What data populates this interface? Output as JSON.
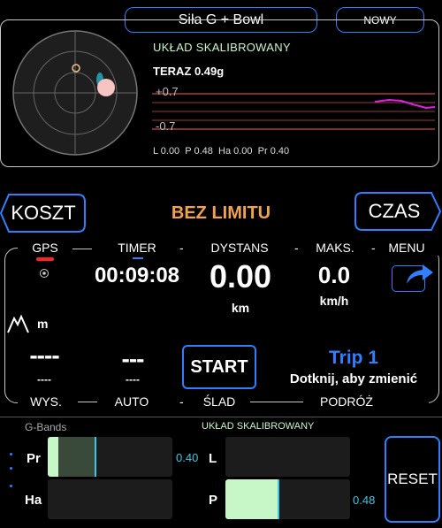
{
  "header": {
    "title": "Siła G + Bowl",
    "new_label": "NOWY"
  },
  "gmeter": {
    "status": "UKŁAD SKALIBROWANY",
    "now_label": "TERAZ 0.49g",
    "top_value": "+0.7",
    "bottom_value": "-0.7",
    "readout": "L 0.00  P 0.48  Ha 0.00  Pr 0.40"
  },
  "middle": {
    "cost_label": "KOSZT",
    "limit_label": "BEZ LIMITU",
    "time_label": "CZAS"
  },
  "dashboard": {
    "gps_label": "GPS",
    "timer_label": "TIMER",
    "distance_label": "DYSTANS",
    "max_label": "MAKS.",
    "menu_label": "MENU",
    "separator": "-",
    "timer_value": "00:09:08",
    "distance_value": "0.00",
    "distance_unit": "km",
    "max_value": "0.0",
    "max_unit": "km/h",
    "altitude_unit": "m",
    "altitude_value": "----",
    "altitude_sub": "----",
    "auto_value": "---",
    "auto_sub": "----",
    "start_label": "START",
    "trip_name": "Trip 1",
    "trip_hint": "Dotknij, aby zmienić",
    "alt_label": "WYS.",
    "auto_label": "AUTO",
    "track_label": "ŚLAD",
    "journey_label": "PODRÓŻ"
  },
  "gbands": {
    "title": "G-Bands",
    "status": "UKŁAD SKALIBROWANY",
    "pr_label": "Pr",
    "pr_value": "0.40",
    "pr_level": 0.4,
    "ha_label": "Ha",
    "ha_level": 0.0,
    "l_label": "L",
    "l_level": 0.0,
    "p_label": "P",
    "p_value": "0.48",
    "p_level": 0.48,
    "reset_label": "RESET"
  },
  "colors": {
    "accent": "#2f7fff",
    "orange": "#f5a04a",
    "green": "#c7f6c7",
    "cyan": "#3ec6e8",
    "magenta": "#e020e0"
  }
}
